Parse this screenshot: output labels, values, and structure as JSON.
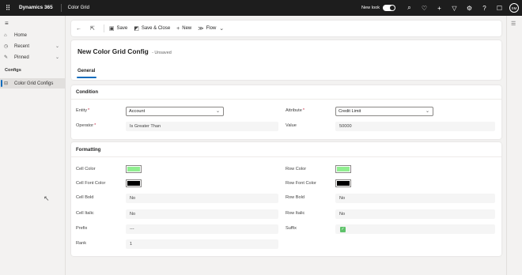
{
  "topbar": {
    "app_name": "Dynamics 365",
    "app_module": "Color Grid",
    "new_look_label": "New look",
    "user_initials": "SM",
    "icons": [
      "waffle-icon",
      "search-icon",
      "lightbulb-icon",
      "plus-icon",
      "filter-icon",
      "settings-icon",
      "help-icon",
      "chat-icon"
    ]
  },
  "sidebar": {
    "items": [
      {
        "label": "Home",
        "icon": "home-icon"
      },
      {
        "label": "Recent",
        "icon": "clock-icon"
      },
      {
        "label": "Pinned",
        "icon": "pin-icon"
      }
    ],
    "group_label": "Configs",
    "active_item": {
      "label": "Color Grid Configs",
      "icon": "grid-icon"
    }
  },
  "commandbar": {
    "save": "Save",
    "save_close": "Save & Close",
    "new": "New",
    "flow": "Flow"
  },
  "header": {
    "title": "New Color Grid Config",
    "status": "- Unsaved",
    "tab": "General"
  },
  "condition": {
    "title": "Condition",
    "entity_label": "Entity",
    "entity_value": "Account",
    "attribute_label": "Attribute",
    "attribute_value": "Credit Limit",
    "operator_label": "Operator",
    "operator_value": "Is Greater Than",
    "value_label": "Value",
    "value_value": "50000",
    "required_mark": "*"
  },
  "formatting": {
    "title": "Formatting",
    "cell_color_label": "Cell Color",
    "cell_color": "#90ee90",
    "row_color_label": "Row Color",
    "row_color": "#90ee90",
    "cell_font_color_label": "Cell Font Color",
    "cell_font_color": "#000000",
    "row_font_color_label": "Row Font Color",
    "row_font_color": "#000000",
    "cell_bold_label": "Cell Bold",
    "cell_bold_value": "No",
    "row_bold_label": "Row Bold",
    "row_bold_value": "No",
    "cell_italic_label": "Cell Italic",
    "cell_italic_value": "No",
    "row_italic_label": "Row Italic",
    "row_italic_value": "No",
    "prefix_label": "Prefix",
    "prefix_value": "---",
    "suffix_label": "Suffix",
    "suffix_checked": true,
    "rank_label": "Rank",
    "rank_value": "1"
  }
}
